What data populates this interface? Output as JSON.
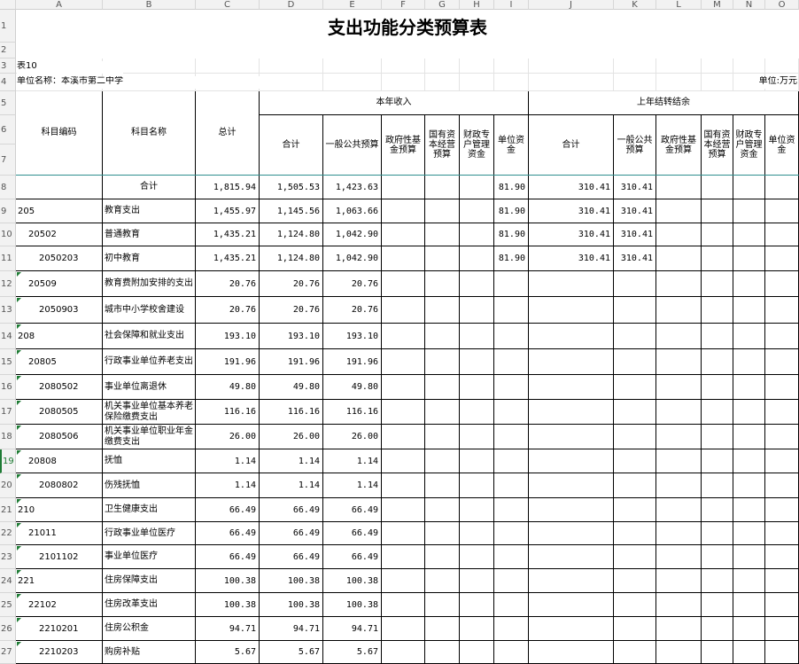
{
  "col_headers": [
    "A",
    "B",
    "C",
    "D",
    "E",
    "F",
    "G",
    "H",
    "I",
    "J",
    "K",
    "L",
    "M",
    "N",
    "O"
  ],
  "row_numbers": [
    "1",
    "2",
    "3",
    "4",
    "5",
    "6",
    "7",
    "8",
    "9",
    "10",
    "11",
    "12",
    "13",
    "14",
    "15",
    "16",
    "17",
    "18",
    "19",
    "20",
    "21",
    "22",
    "23",
    "24",
    "25",
    "26",
    "27"
  ],
  "sheet": {
    "title": "支出功能分类预算表",
    "table_no": "表10",
    "unit_name": "单位名称：本溪市第二中学",
    "unit": "单位:万元"
  },
  "headers": {
    "subject_code": "科目编码",
    "subject_name": "科目名称",
    "total": "总计",
    "current_income": "本年收入",
    "prior_carryover": "上年结转结余",
    "sub": {
      "sum": "合计",
      "general_budget": "一般公共预算",
      "gov_fund": "政府性基金预算",
      "state_capital": "国有资本经营预算",
      "special_account": "财政专户管理资金",
      "unit_fund": "单位资金",
      "sum2": "合计",
      "general_budget2": "一般公共预算",
      "gov_fund2": "政府性基金预算",
      "state_capital2": "国有资本经营预算",
      "special_account2": "财政专户管理资金",
      "unit_fund2": "单位资金"
    }
  },
  "rows": [
    {
      "code": "",
      "name": "合计",
      "total": "1,815.94",
      "sum": "1,505.53",
      "gen": "1,423.63",
      "unit": "81.90",
      "csum": "310.41",
      "cgen": "310.41"
    },
    {
      "code": "205",
      "name": "教育支出",
      "total": "1,455.97",
      "sum": "1,145.56",
      "gen": "1,063.66",
      "unit": "81.90",
      "csum": "310.41",
      "cgen": "310.41"
    },
    {
      "code": "20502",
      "name": "普通教育",
      "total": "1,435.21",
      "sum": "1,124.80",
      "gen": "1,042.90",
      "unit": "81.90",
      "csum": "310.41",
      "cgen": "310.41"
    },
    {
      "code": "2050203",
      "name": "初中教育",
      "total": "1,435.21",
      "sum": "1,124.80",
      "gen": "1,042.90",
      "unit": "81.90",
      "csum": "310.41",
      "cgen": "310.41"
    },
    {
      "code": "20509",
      "name": "教育费附加安排的支出",
      "total": "20.76",
      "sum": "20.76",
      "gen": "20.76"
    },
    {
      "code": "2050903",
      "name": "城市中小学校舍建设",
      "total": "20.76",
      "sum": "20.76",
      "gen": "20.76"
    },
    {
      "code": "208",
      "name": "社会保障和就业支出",
      "total": "193.10",
      "sum": "193.10",
      "gen": "193.10"
    },
    {
      "code": "20805",
      "name": "行政事业单位养老支出",
      "total": "191.96",
      "sum": "191.96",
      "gen": "191.96"
    },
    {
      "code": "2080502",
      "name": "事业单位离退休",
      "total": "49.80",
      "sum": "49.80",
      "gen": "49.80"
    },
    {
      "code": "2080505",
      "name": "机关事业单位基本养老保险缴费支出",
      "total": "116.16",
      "sum": "116.16",
      "gen": "116.16"
    },
    {
      "code": "2080506",
      "name": "机关事业单位职业年金缴费支出",
      "total": "26.00",
      "sum": "26.00",
      "gen": "26.00"
    },
    {
      "code": "20808",
      "name": "抚恤",
      "total": "1.14",
      "sum": "1.14",
      "gen": "1.14"
    },
    {
      "code": "2080802",
      "name": "伤残抚恤",
      "total": "1.14",
      "sum": "1.14",
      "gen": "1.14"
    },
    {
      "code": "210",
      "name": "卫生健康支出",
      "total": "66.49",
      "sum": "66.49",
      "gen": "66.49"
    },
    {
      "code": "21011",
      "name": "行政事业单位医疗",
      "total": "66.49",
      "sum": "66.49",
      "gen": "66.49"
    },
    {
      "code": "2101102",
      "name": "事业单位医疗",
      "total": "66.49",
      "sum": "66.49",
      "gen": "66.49"
    },
    {
      "code": "221",
      "name": "住房保障支出",
      "total": "100.38",
      "sum": "100.38",
      "gen": "100.38"
    },
    {
      "code": "22102",
      "name": "住房改革支出",
      "total": "100.38",
      "sum": "100.38",
      "gen": "100.38"
    },
    {
      "code": "2210201",
      "name": "住房公积金",
      "total": "94.71",
      "sum": "94.71",
      "gen": "94.71"
    },
    {
      "code": "2210203",
      "name": "购房补贴",
      "total": "5.67",
      "sum": "5.67",
      "gen": "5.67"
    }
  ]
}
